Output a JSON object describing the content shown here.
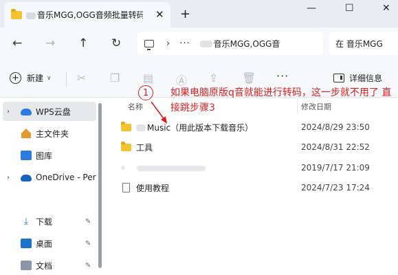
{
  "window": {
    "tab_title": "音乐MGG,OGG音频批量转码",
    "tab_close": "✕",
    "new_tab": "+",
    "minimize": "—",
    "maximize": "☐",
    "close": "✕"
  },
  "nav": {
    "back": "←",
    "forward": "→",
    "up": "↑",
    "refresh": "↻",
    "chevron": "›",
    "ellipsis": "···",
    "address_path": "音乐MGG,OGG音",
    "search_placeholder": "在 音乐MGG"
  },
  "toolbar": {
    "new_label": "新建",
    "new_dropdown": "∨",
    "more_label": "···",
    "details_label": "详细信息",
    "icons": [
      "cut-icon",
      "copy-icon",
      "paste-icon",
      "rename-icon",
      "share-icon",
      "delete-icon"
    ]
  },
  "sidebar": {
    "items": [
      {
        "label": "WPS云盘",
        "icon": "cloud-icon",
        "expandable": true,
        "selected": true
      },
      {
        "label": "主文件夹",
        "icon": "home-icon",
        "expandable": false
      },
      {
        "label": "图库",
        "icon": "gallery-icon",
        "expandable": false
      },
      {
        "label": "OneDrive - Per",
        "icon": "onedrive-icon",
        "expandable": true
      },
      {
        "label": "下载",
        "icon": "download-icon",
        "pinned": true
      },
      {
        "label": "桌面",
        "icon": "desktop-icon",
        "pinned": true
      },
      {
        "label": "文档",
        "icon": "document-icon",
        "pinned": true
      }
    ],
    "expand_glyph": "›",
    "pin_glyph": "✎"
  },
  "columns": {
    "name": "名称",
    "modified": "修改日期"
  },
  "files": [
    {
      "name": "Music（用此版本下载音乐）",
      "date": "2024/8/29 23:50",
      "type": "folder"
    },
    {
      "name": "工具",
      "date": "2024/8/31 22:52",
      "type": "folder"
    },
    {
      "name": "",
      "date": "2019/7/17 21:09",
      "type": "blank"
    },
    {
      "name": "使用教程",
      "date": "2024/7/23 17:24",
      "type": "file"
    }
  ],
  "annotation": {
    "number": "1",
    "text": "如果电脑原版q音就能进行转码，这一步就不用了  直接跳步骤3",
    "color": "#d81f1f"
  }
}
